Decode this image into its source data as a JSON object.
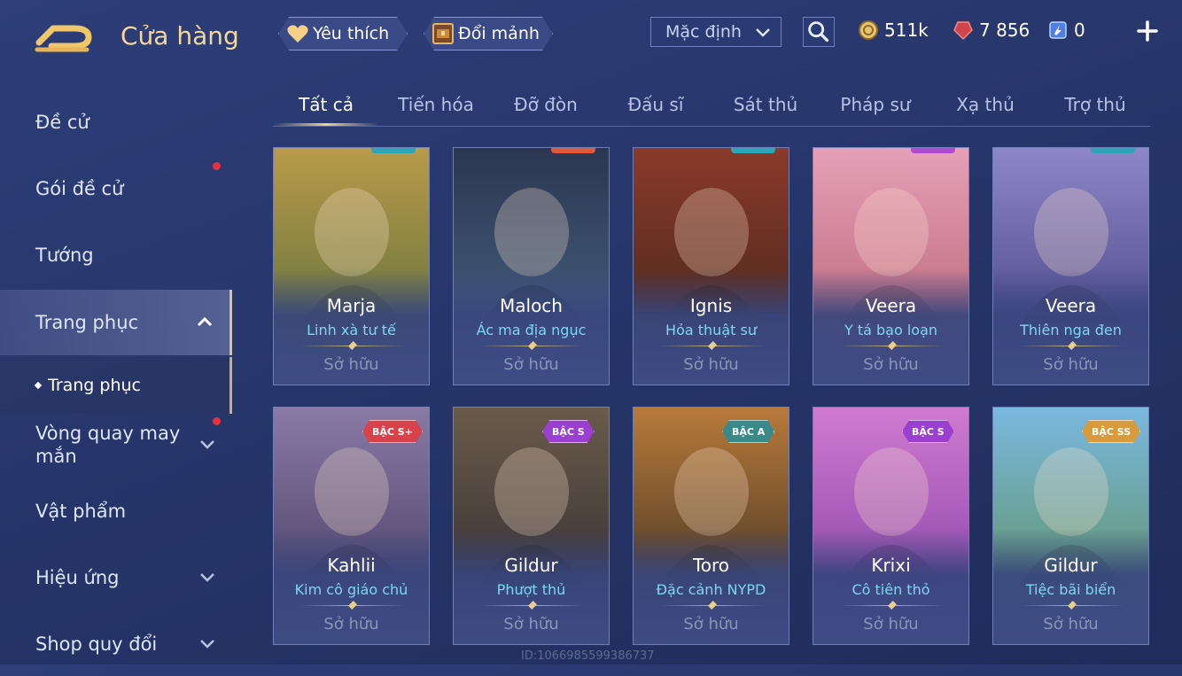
{
  "header": {
    "title": "Cửa hàng",
    "favorites_label": "Yêu thích",
    "fragment_label": "Đổi mảnh",
    "sort_value": "Mặc định",
    "currency": {
      "gold": "511k",
      "ruby": "7 856",
      "voucher": "0"
    }
  },
  "sidebar": {
    "items": [
      {
        "label": "Đề cử"
      },
      {
        "label": "Gói đề cử"
      },
      {
        "label": "Tướng"
      },
      {
        "label": "Trang phục"
      },
      {
        "label": "Vòng quay may mắn"
      },
      {
        "label": "Vật phẩm"
      },
      {
        "label": "Hiệu ứng"
      },
      {
        "label": "Shop quy đổi"
      }
    ],
    "sub_item": "Trang phục"
  },
  "tabs": [
    "Tất cả",
    "Tiến hóa",
    "Đỡ đòn",
    "Đấu sĩ",
    "Sát thủ",
    "Pháp sư",
    "Xạ thủ",
    "Trợ thủ"
  ],
  "cards": [
    {
      "name": "Marja",
      "skin": "Linh xà tư tế",
      "status": "Sở hữu",
      "rank": ""
    },
    {
      "name": "Maloch",
      "skin": "Ác ma địa ngục",
      "status": "Sở hữu",
      "rank": ""
    },
    {
      "name": "Ignis",
      "skin": "Hỏa thuật sư",
      "status": "Sở hữu",
      "rank": ""
    },
    {
      "name": "Veera",
      "skin": "Y tá bạo loạn",
      "status": "Sở hữu",
      "rank": ""
    },
    {
      "name": "Veera",
      "skin": "Thiên nga đen",
      "status": "Sở hữu",
      "rank": ""
    },
    {
      "name": "Kahlii",
      "skin": "Kim cô giáo chủ",
      "status": "Sở hữu",
      "rank": "BẬC S+"
    },
    {
      "name": "Gildur",
      "skin": "Phượt thủ",
      "status": "Sở hữu",
      "rank": "BẬC S"
    },
    {
      "name": "Toro",
      "skin": "Đặc cảnh NYPD",
      "status": "Sở hữu",
      "rank": "BẬC A"
    },
    {
      "name": "Krixi",
      "skin": "Cô tiên thỏ",
      "status": "Sở hữu",
      "rank": "BẬC S"
    },
    {
      "name": "Gildur",
      "skin": "Tiệc bãi biển",
      "status": "Sở hữu",
      "rank": "BẬC SS"
    }
  ],
  "watermark": "ID:1066985599386737",
  "colors": {
    "accent_gold": "#f3d79c",
    "skin_name": "#7fd6f2",
    "notification": "#e5323e"
  }
}
